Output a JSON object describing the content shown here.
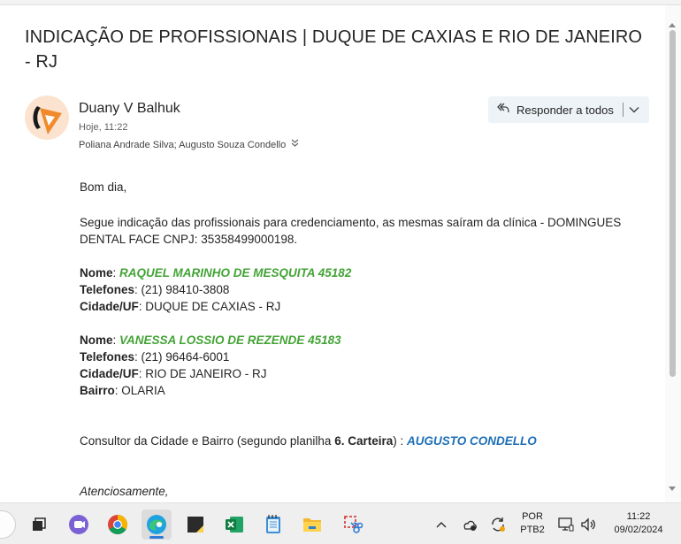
{
  "email": {
    "subject": "INDICAÇÃO DE PROFISSIONAIS | DUQUE DE CAXIAS E RIO DE JANEIRO - RJ",
    "sender": "Duany V Balhuk",
    "datetime": "Hoje, 11:22",
    "recipients": "Poliana Andrade Silva; Augusto Souza Condello",
    "reply_all_label": "Responder a todos"
  },
  "body": {
    "greeting": "Bom dia,",
    "intro": "Segue indicação das profissionais para credenciamento, as mesmas saíram da clínica - DOMINGUES DENTAL FACE CNPJ: 35358499000198.",
    "label_nome": "Nome",
    "label_telefones": "Telefones",
    "label_cidade": "Cidade/UF",
    "label_bairro": "Bairro",
    "professional1": {
      "nome": "RAQUEL MARINHO DE MESQUITA 45182",
      "telefones": "(21) 98410-3808",
      "cidade": "DUQUE DE CAXIAS - RJ"
    },
    "professional2": {
      "nome": "VANESSA LOSSIO DE REZENDE 45183",
      "telefones": "(21) 96464-6001",
      "cidade": "RIO DE JANEIRO - RJ",
      "bairro": "OLARIA"
    },
    "consultant_prefix": "Consultor da Cidade e Bairro (segundo planilha ",
    "consultant_sheet": "6. Carteira",
    "consultant_mid": ") : ",
    "consultant_name": "AUGUSTO CONDELLO",
    "closing": "Atenciosamente,"
  },
  "taskbar": {
    "icons": [
      "task-view-icon",
      "teams-icon",
      "chrome-icon",
      "edge-icon",
      "sticky-notes-icon",
      "excel-icon",
      "notepad-icon",
      "file-explorer-icon",
      "snipping-tool-icon"
    ],
    "lang_line1": "POR",
    "lang_line2": "PTB2",
    "time": "11:22",
    "date": "09/02/2024"
  },
  "colors": {
    "accent_green": "#43a336",
    "accent_blue": "#1e6fb7",
    "reply_button_bg": "#eef3f7"
  }
}
